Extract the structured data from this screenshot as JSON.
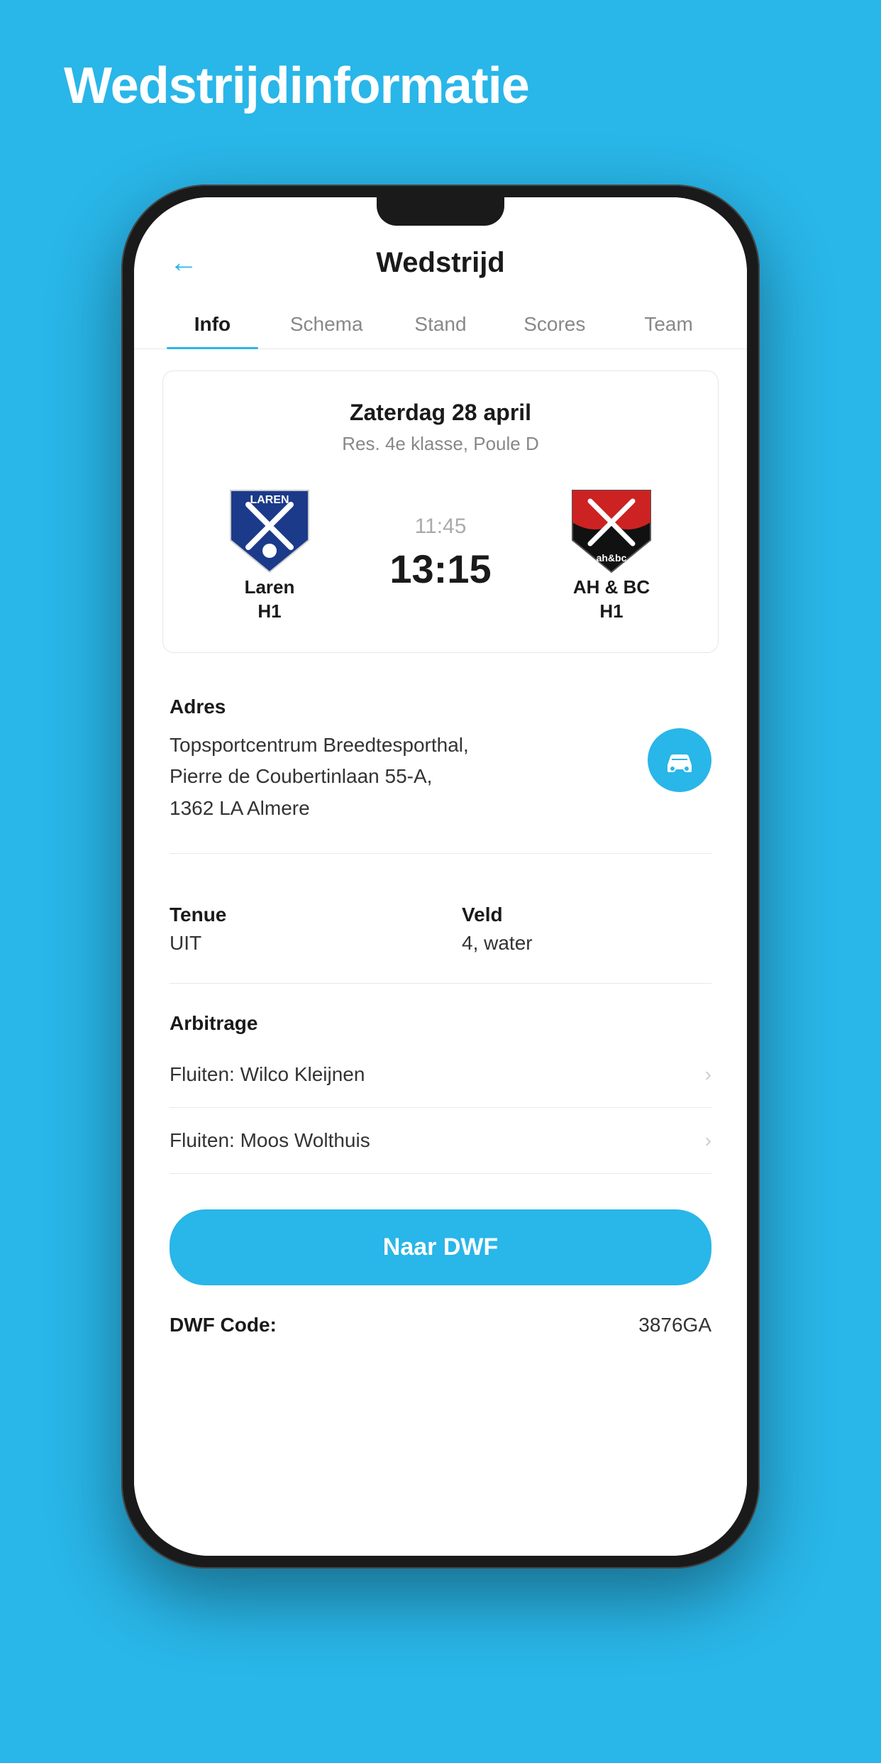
{
  "page": {
    "background_title": "Wedstrijdinformatie",
    "header": {
      "title": "Wedstrijd",
      "back_label": "←"
    },
    "tabs": [
      {
        "id": "info",
        "label": "Info",
        "active": true
      },
      {
        "id": "schema",
        "label": "Schema",
        "active": false
      },
      {
        "id": "stand",
        "label": "Stand",
        "active": false
      },
      {
        "id": "scores",
        "label": "Scores",
        "active": false
      },
      {
        "id": "team",
        "label": "Team",
        "active": false
      }
    ],
    "match": {
      "date": "Zaterdag 28 april",
      "league": "Res. 4e klasse, Poule D",
      "home_team": {
        "name": "Laren",
        "sub": "H1"
      },
      "away_team": {
        "name": "AH & BC",
        "sub": "H1"
      },
      "score_time": "11:45",
      "score_main": "13:15"
    },
    "address": {
      "title": "Adres",
      "text": "Topsportcentrum Breedtesporthal,\nPierre de Coubertinlaan 55-A,\n1362 LA Almere"
    },
    "tenue": {
      "label": "Tenue",
      "value": "UIT"
    },
    "veld": {
      "label": "Veld",
      "value": "4, water"
    },
    "arbitrage": {
      "title": "Arbitrage",
      "items": [
        {
          "text": "Fluiten: Wilco Kleijnen"
        },
        {
          "text": "Fluiten: Moos Wolthuis"
        }
      ]
    },
    "dwf": {
      "button_label": "Naar DWF",
      "code_label": "DWF Code:",
      "code_value": "3876GA"
    }
  }
}
